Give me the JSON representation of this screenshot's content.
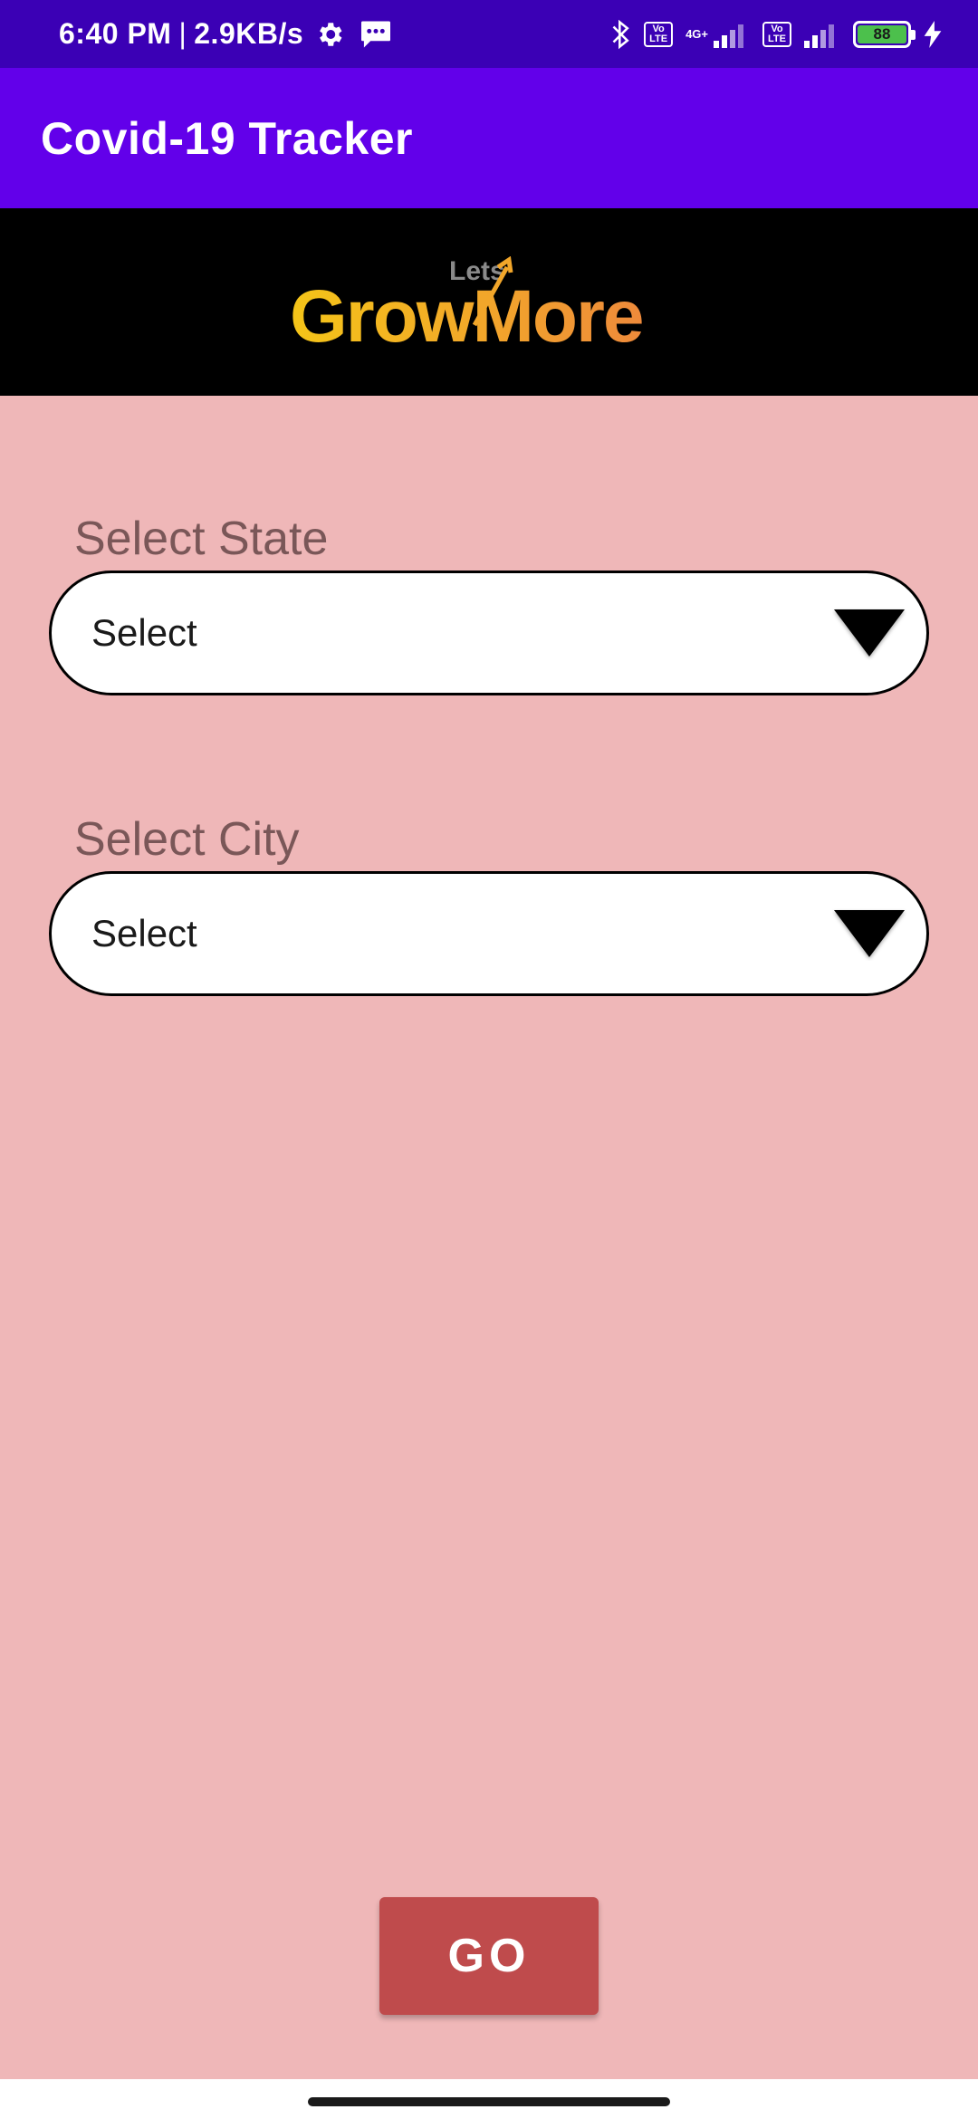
{
  "status_bar": {
    "time": "6:40 PM",
    "separator": "|",
    "net_speed": "2.9KB/s",
    "volte_label": "Vo LTE",
    "net_type": "4G+",
    "battery": "88",
    "icons": [
      "gear-icon",
      "message-icon",
      "bluetooth-icon",
      "volte-icon",
      "signal-icon",
      "battery-icon",
      "charging-icon"
    ]
  },
  "app_bar": {
    "title": "Covid-19 Tracker"
  },
  "banner": {
    "logo_small": "Lets",
    "logo_main": "GrowMore"
  },
  "form": {
    "state": {
      "label": "Select State",
      "value": "Select"
    },
    "city": {
      "label": "Select City",
      "value": "Select"
    }
  },
  "go_button": {
    "label": "GO"
  },
  "colors": {
    "status_bar": "#3b00b5",
    "app_bar": "#6200ea",
    "background": "#efb7b8",
    "button": "#bf4b4c",
    "label": "#7a5758"
  }
}
